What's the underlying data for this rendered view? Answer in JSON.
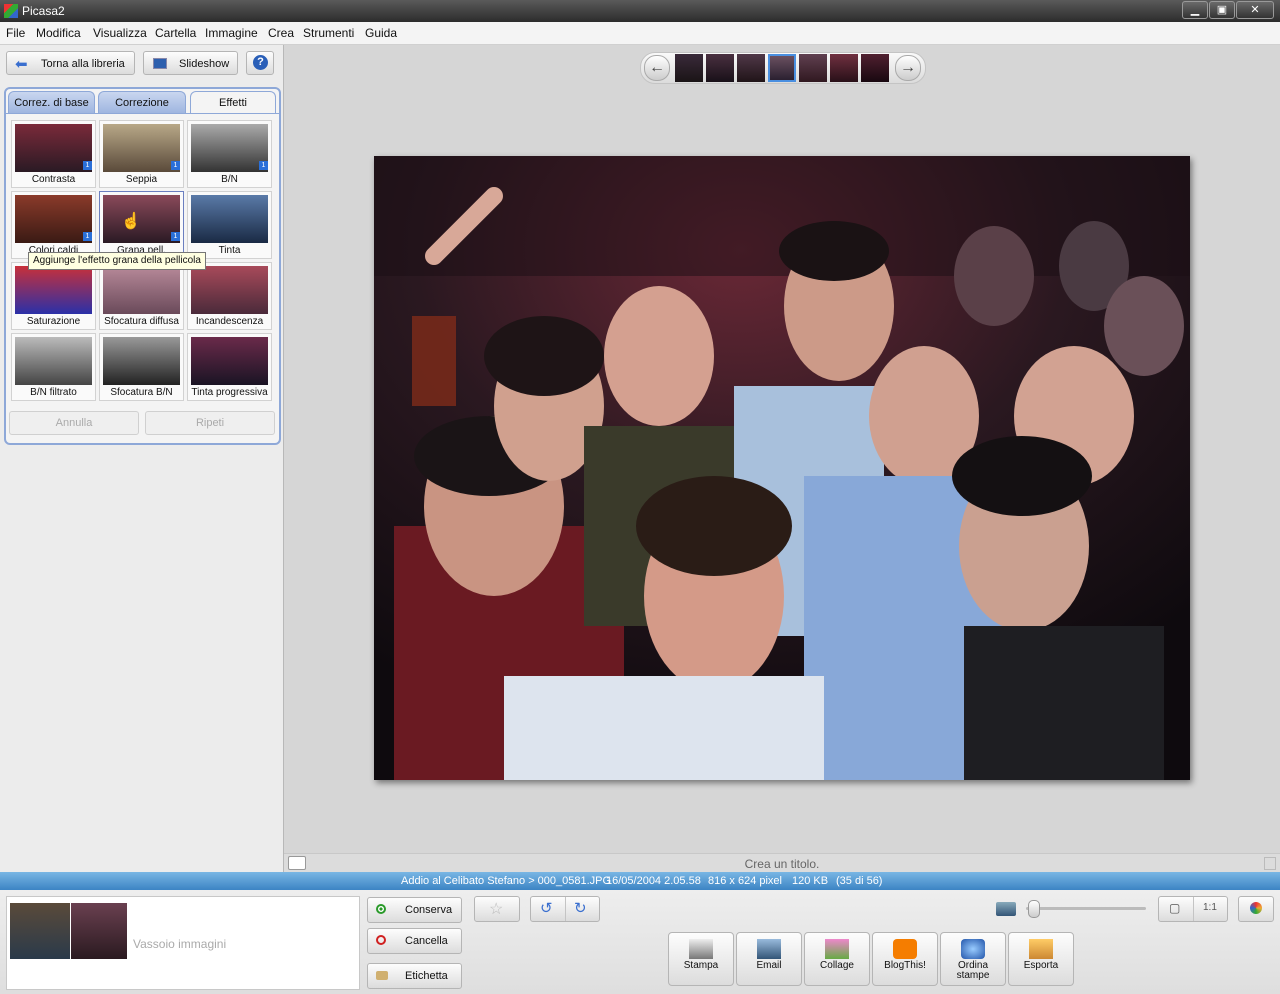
{
  "window": {
    "title": "Picasa2",
    "minimize": "▁",
    "maximize": "▣",
    "close": "✕"
  },
  "menu": [
    "File",
    "Modifica",
    "Visualizza",
    "Cartella",
    "Immagine",
    "Crea",
    "Strumenti",
    "Guida"
  ],
  "toolbar": {
    "back_label": "Torna alla libreria",
    "slideshow_label": "Slideshow",
    "help_label": "?"
  },
  "tabs": [
    "Correz. di base",
    "Correzione",
    "Effetti"
  ],
  "effects": [
    {
      "label": "Contrasta",
      "badge": "1"
    },
    {
      "label": "Seppia",
      "badge": "1"
    },
    {
      "label": "B/N",
      "badge": "1"
    },
    {
      "label": "Colori caldi",
      "badge": "1"
    },
    {
      "label": "Grana pell.",
      "badge": "1"
    },
    {
      "label": "Tinta",
      "badge": ""
    },
    {
      "label": "Saturazione",
      "badge": ""
    },
    {
      "label": "Sfocatura diffusa",
      "badge": ""
    },
    {
      "label": "Incandescenza",
      "badge": ""
    },
    {
      "label": "B/N filtrato",
      "badge": ""
    },
    {
      "label": "Sfocatura B/N",
      "badge": ""
    },
    {
      "label": "Tinta progressiva",
      "badge": ""
    }
  ],
  "tooltip": "Aggiunge l'effetto grana della pellicola",
  "undo": {
    "annulla": "Annulla",
    "ripeti": "Ripeti"
  },
  "filmstrip": {
    "prev": "←",
    "next": "→"
  },
  "caption": {
    "placeholder": "Crea un titolo."
  },
  "info": {
    "path": "Addio al Celibato Stefano > 000_0581.JPG",
    "date": "16/05/2004 2.05.58",
    "size": "816 x 624 pixel",
    "filesize": "120 KB",
    "index": "(35 di 56)"
  },
  "tray": {
    "label": "Vassoio immagini"
  },
  "actions": {
    "conserva": "Conserva",
    "cancella": "Cancella",
    "etichetta": "Etichetta"
  },
  "view_buttons": {
    "fit": "▢",
    "actual": "1:1"
  },
  "output": [
    {
      "label": "Stampa"
    },
    {
      "label": "Email"
    },
    {
      "label": "Collage"
    },
    {
      "label": "BlogThis!"
    },
    {
      "label": "Ordina stampe"
    },
    {
      "label": "Esporta"
    }
  ]
}
